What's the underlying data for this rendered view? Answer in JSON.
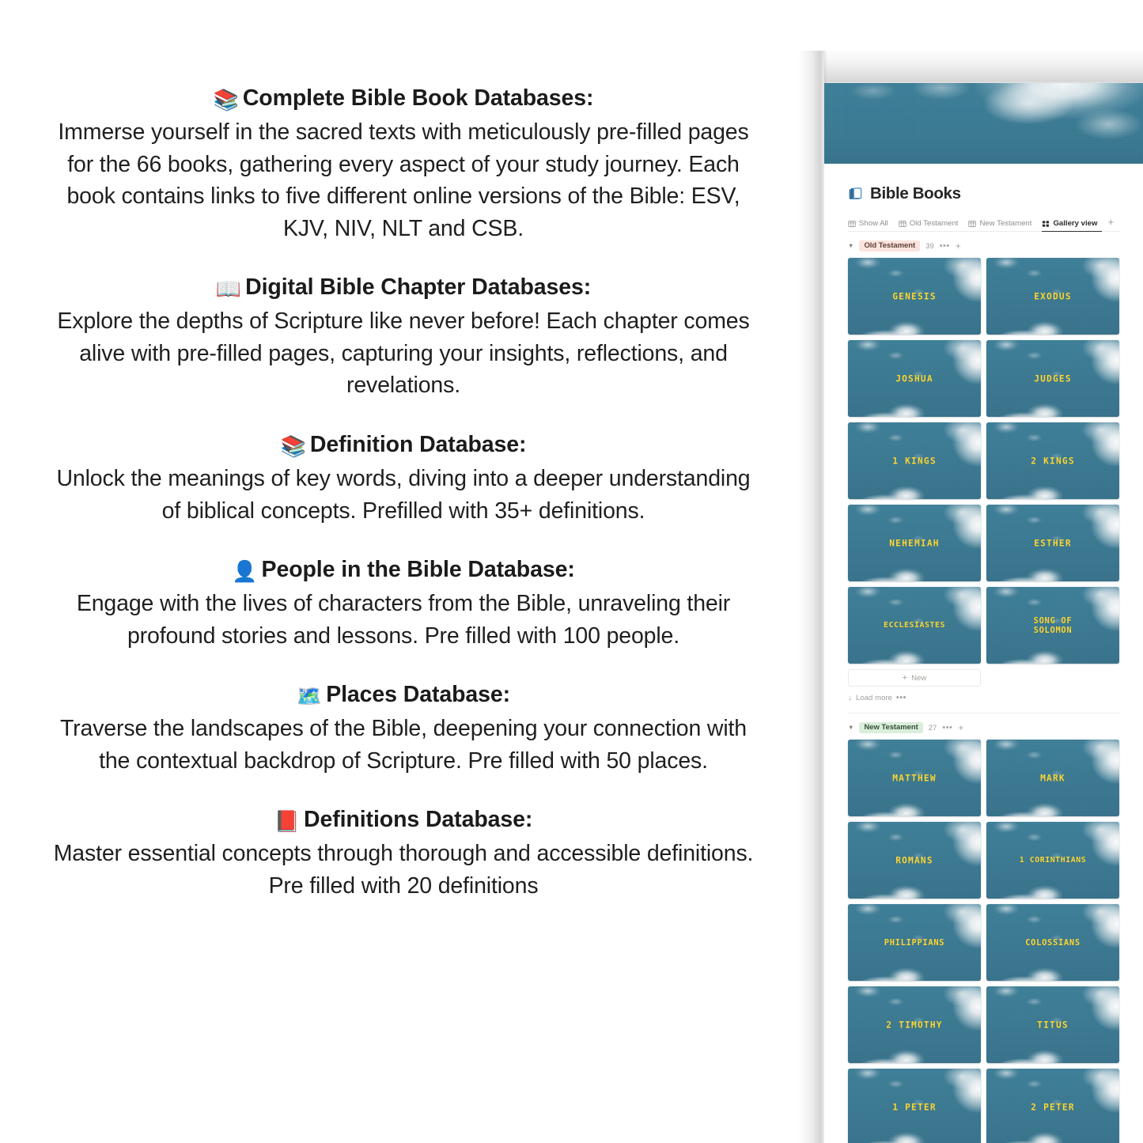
{
  "features": [
    {
      "emoji": "📚",
      "icon_name": "books-icon",
      "heading": "Complete Bible Book Databases:",
      "body": "Immerse yourself in the sacred texts with meticulously pre-filled pages for the 66 books, gathering every aspect of your study journey. Each book contains links to five different online versions of the Bible: ESV, KJV, NIV, NLT and CSB."
    },
    {
      "emoji": "📖",
      "icon_name": "open-book-icon",
      "heading": "Digital Bible Chapter Databases:",
      "body": "Explore the depths of Scripture like never before! Each chapter comes alive with pre-filled pages, capturing your insights, reflections, and revelations."
    },
    {
      "emoji": "📚",
      "icon_name": "books-icon",
      "heading": "Definition Database:",
      "body": "Unlock the meanings of key words, diving into a deeper understanding of biblical concepts. Prefilled with 35+ definitions."
    },
    {
      "emoji": "👤",
      "icon_name": "person-silhouette-icon",
      "heading": "People in the Bible Database:",
      "body": "Engage with the lives of characters from the Bible, unraveling their profound stories and lessons. Pre filled with 100 people."
    },
    {
      "emoji": "🗺️",
      "icon_name": "world-map-icon",
      "heading": "Places Database:",
      "body": "Traverse the landscapes of the Bible, deepening your connection with the contextual backdrop of Scripture. Pre filled with 50 places."
    },
    {
      "emoji": "📕",
      "icon_name": "closed-book-icon",
      "heading": "Definitions Database:",
      "body": "Master essential concepts through thorough and accessible definitions. Pre filled with 20 definitions"
    }
  ],
  "notion": {
    "page_title": "Bible Books",
    "page_icon_name": "blue-books-icon",
    "view_tabs": [
      {
        "label": "Show All",
        "icon": "table-icon",
        "active": false
      },
      {
        "label": "Old Testament",
        "icon": "table-icon",
        "active": false
      },
      {
        "label": "New Testament",
        "icon": "table-icon",
        "active": false
      },
      {
        "label": "Gallery view",
        "icon": "gallery-icon",
        "active": true
      }
    ],
    "add_view_label": "+",
    "groups": [
      {
        "name": "Old Testament",
        "count": "39",
        "pill_color": "#fbe4dd",
        "pill_text_color": "#5d3f36",
        "cards": [
          "GENESIS",
          "EXODUS",
          "JOSHUA",
          "JUDGES",
          "1 KINGS",
          "2 KINGS",
          "NEHEMIAH",
          "ESTHER",
          "ECCLESIASTES",
          "SONG OF\nSOLOMON"
        ],
        "new_label": "New",
        "load_more_label": "Load more"
      },
      {
        "name": "New Testament",
        "count": "27",
        "pill_color": "#dbeddb",
        "pill_text_color": "#33503b",
        "cards": [
          "MATTHEW",
          "MARK",
          "ROMANS",
          "1 CORINTHIANS",
          "PHILIPPIANS",
          "COLOSSIANS",
          "2 TIMOTHY",
          "TITUS",
          "1 PETER",
          "2 PETER"
        ]
      }
    ],
    "colors": {
      "sky": "#3a7a93",
      "card_text": "#fcd736",
      "title": "#252525",
      "muted": "#9b9a95"
    }
  }
}
